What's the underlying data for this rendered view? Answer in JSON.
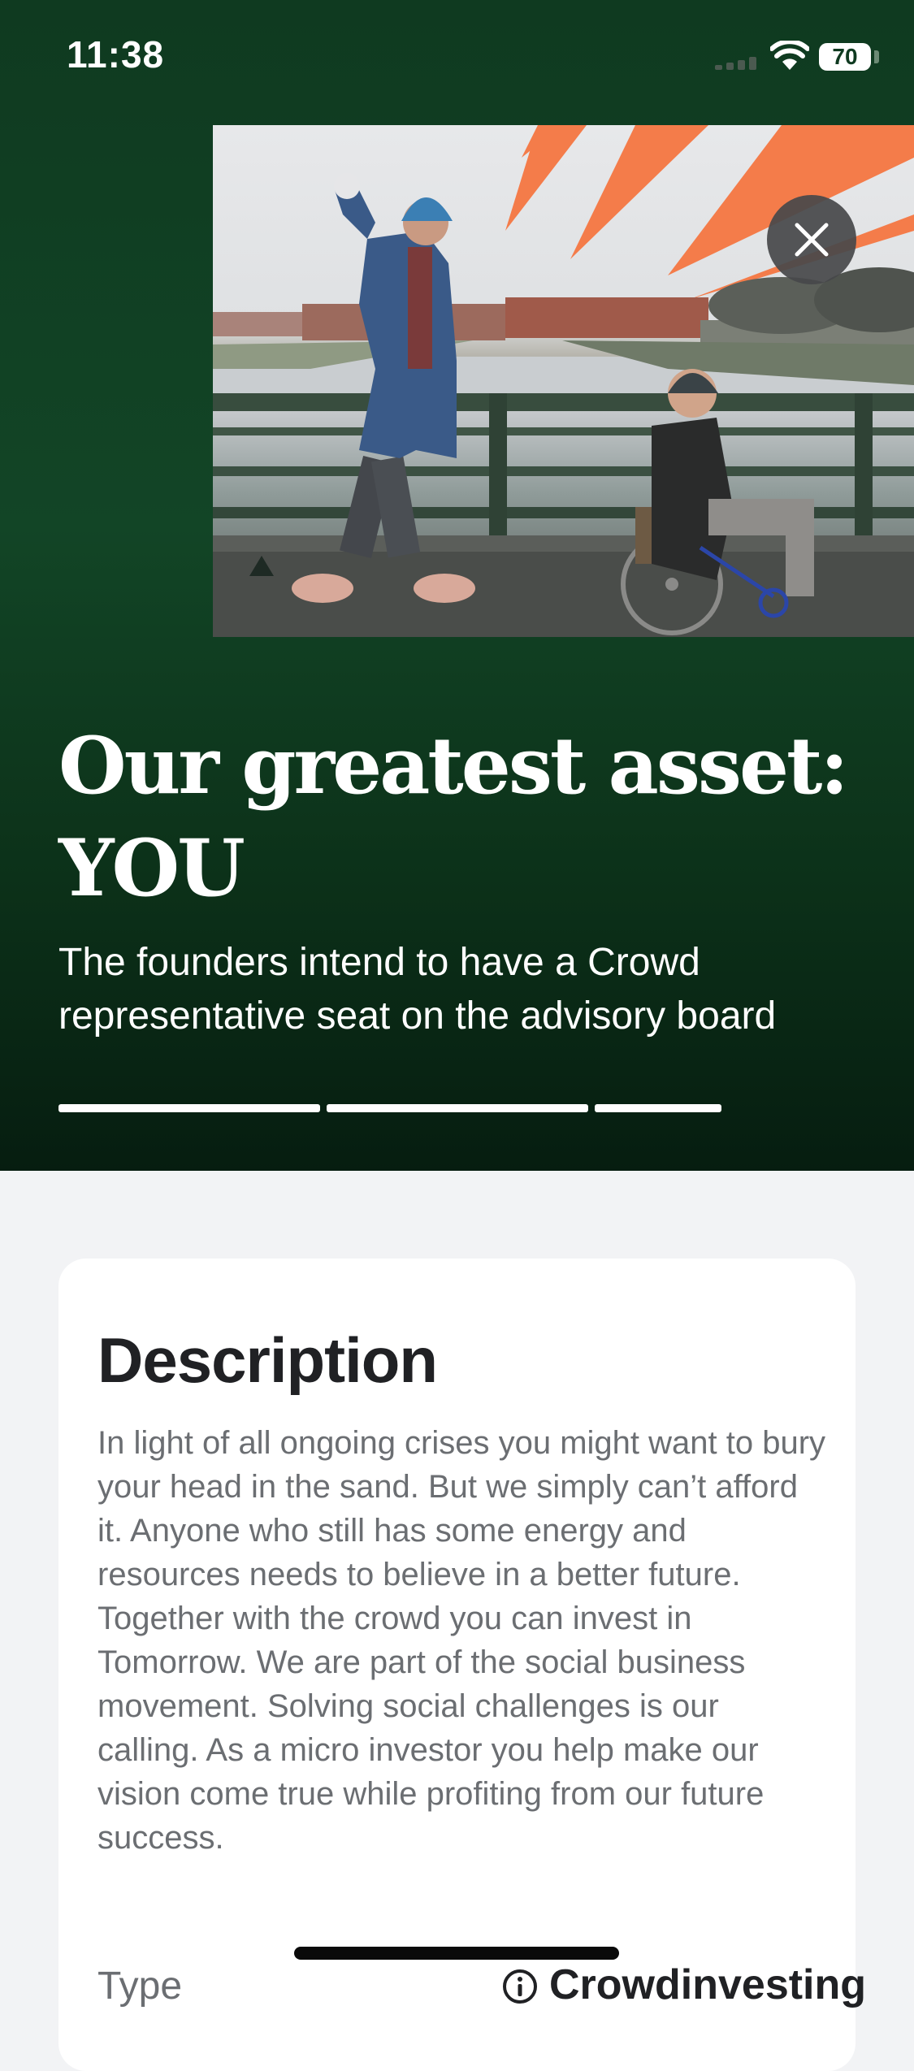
{
  "status_bar": {
    "time": "11:38",
    "battery": "70"
  },
  "hero": {
    "title_line1": "Our greatest asset:",
    "title_line2": "YOU",
    "subtitle": "The founders intend to have a Crowd representative seat on the advisory board",
    "background_color": "#0f3a20",
    "accent_color": "#f47c4a",
    "progress": {
      "segments_total": 3,
      "segment_fills": [
        1,
        1,
        0.47
      ]
    }
  },
  "icons": {
    "close": "close-icon",
    "info": "info-icon",
    "wifi": "wifi-icon",
    "cellular": "cellular-signal-icon",
    "battery": "battery-icon"
  },
  "description": {
    "heading": "Description",
    "body": "In light of all ongoing crises you might want to bury your head in the sand. But we simply can’t afford it. Anyone who still has some energy and resources needs to believe in a better future. Together with the crowd you can invest in Tomorrow. We are part of the social business movement. Solving social challenges is our calling. As a micro investor you help make our vision come true while profiting from our future success."
  },
  "type_row": {
    "label": "Type",
    "value": "Crowdinvesting"
  }
}
